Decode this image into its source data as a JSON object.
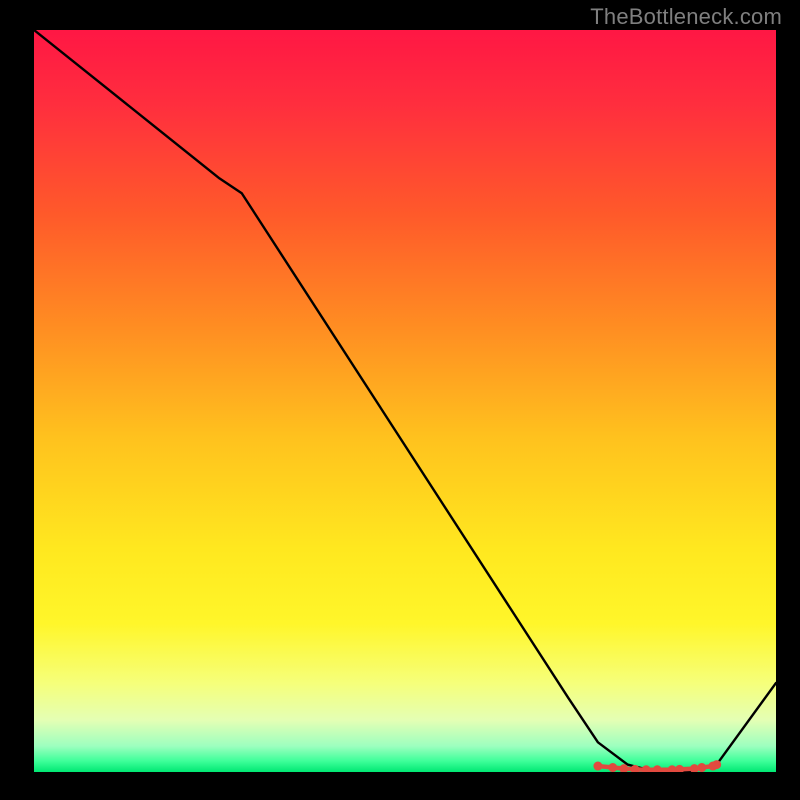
{
  "watermark": "TheBottleneck.com",
  "chart_data": {
    "type": "line",
    "title": "",
    "xlabel": "",
    "ylabel": "",
    "xlim": [
      0,
      100
    ],
    "ylim": [
      0,
      100
    ],
    "background_gradient": {
      "stops": [
        {
          "offset": 0.0,
          "color": "#ff1744"
        },
        {
          "offset": 0.1,
          "color": "#ff2e3e"
        },
        {
          "offset": 0.25,
          "color": "#ff5a2a"
        },
        {
          "offset": 0.4,
          "color": "#ff8d22"
        },
        {
          "offset": 0.55,
          "color": "#ffc21e"
        },
        {
          "offset": 0.7,
          "color": "#ffe81f"
        },
        {
          "offset": 0.8,
          "color": "#fff62a"
        },
        {
          "offset": 0.88,
          "color": "#f6ff7a"
        },
        {
          "offset": 0.93,
          "color": "#e4ffb4"
        },
        {
          "offset": 0.965,
          "color": "#9dffbf"
        },
        {
          "offset": 0.985,
          "color": "#3fff9a"
        },
        {
          "offset": 1.0,
          "color": "#00e873"
        }
      ]
    },
    "series": [
      {
        "name": "curve",
        "x": [
          0,
          10,
          25,
          28,
          72,
          76,
          80,
          84,
          88,
          92,
          100
        ],
        "y": [
          100,
          92,
          80,
          78,
          10,
          4,
          1,
          0,
          0,
          1,
          12
        ]
      }
    ],
    "markers": {
      "name": "optimal-band",
      "color": "#e24a3f",
      "x": [
        76,
        78,
        79.5,
        81,
        82.5,
        84,
        86,
        87,
        89,
        90,
        91.5,
        92
      ],
      "y": [
        0.8,
        0.6,
        0.45,
        0.35,
        0.3,
        0.3,
        0.3,
        0.35,
        0.45,
        0.6,
        0.8,
        1.0
      ]
    }
  }
}
